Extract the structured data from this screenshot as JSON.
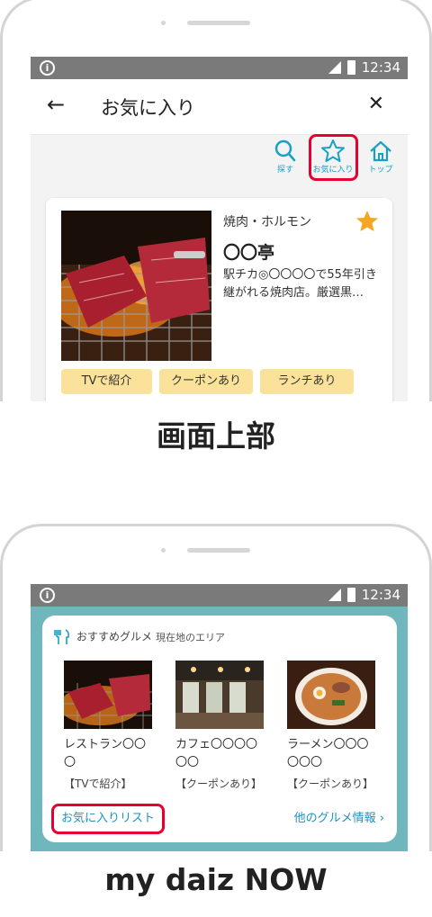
{
  "top_screen": {
    "status": {
      "time": "12:34"
    },
    "appbar": {
      "back": "←",
      "title": "お気に入り",
      "close": "✕"
    },
    "toolbar": [
      {
        "label": "探す",
        "icon": "search-icon"
      },
      {
        "label": "お気に入り",
        "icon": "star-outline-icon",
        "highlighted": true
      },
      {
        "label": "トップ",
        "icon": "home-icon"
      }
    ],
    "card": {
      "category": "焼肉・ホルモン",
      "name": "〇〇亭",
      "description": "駅チカ◎〇〇〇〇で55年引き継がれる焼肉店。厳選黒…",
      "favorite": true,
      "tags": [
        "TVで紹介",
        "クーポンあり",
        "ランチあり"
      ]
    }
  },
  "captions": {
    "top": "画面上部",
    "bottom": "my daiz NOW"
  },
  "bottom_screen": {
    "status": {
      "time": "12:34"
    },
    "widget": {
      "title": "おすすめグルメ",
      "subtitle": "現在地のエリア",
      "items": [
        {
          "name": "レストラン〇〇〇",
          "tag": "【TVで紹介】"
        },
        {
          "name": "カフェ〇〇〇〇〇〇",
          "tag": "【クーポンあり】"
        },
        {
          "name": "ラーメン〇〇〇〇〇〇",
          "tag": "【クーポンあり】"
        }
      ],
      "favorites_link": "お気に入りリスト",
      "more_link": "他のグルメ情報",
      "more_chevron": "›"
    }
  },
  "colors": {
    "accent": "#19a0c8",
    "highlight": "#e6002d",
    "tag_bg": "#fbe29a",
    "widget_bg": "#6fb7bd",
    "star": "#f5a623"
  }
}
